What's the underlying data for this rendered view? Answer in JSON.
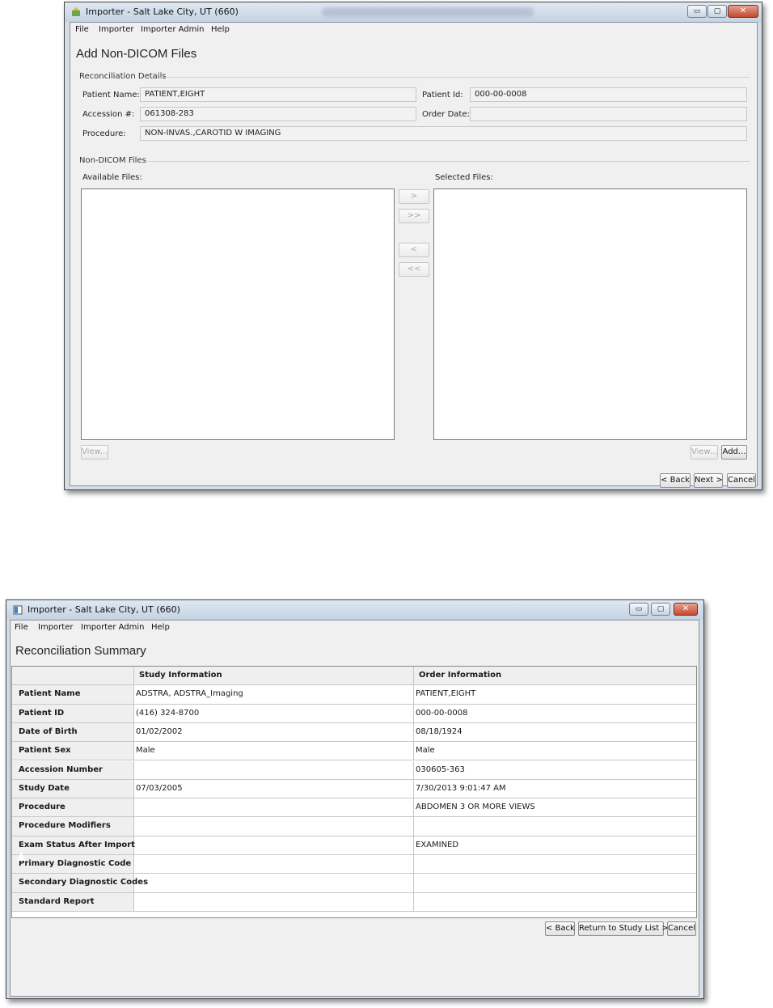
{
  "window1": {
    "title": "Importer - Salt Lake City, UT (660)",
    "menu": [
      "File",
      "Importer",
      "Importer Admin",
      "Help"
    ],
    "heading": "Add Non-DICOM Files",
    "reconciliation": {
      "group_label": "Reconciliation Details",
      "patient_name_label": "Patient Name:",
      "patient_name": "PATIENT,EIGHT",
      "patient_id_label": "Patient Id:",
      "patient_id": "000-00-0008",
      "accession_label": "Accession #:",
      "accession": "061308-283",
      "order_date_label": "Order Date:",
      "order_date": "",
      "procedure_label": "Procedure:",
      "procedure": "NON-INVAS.,CAROTID W IMAGING"
    },
    "files": {
      "group_label": "Non-DICOM Files",
      "available_label": "Available Files:",
      "selected_label": "Selected Files:",
      "move_one": ">",
      "move_all": ">>",
      "remove_one": "<",
      "remove_all": "<<",
      "view_left": "View...",
      "view_right": "View...",
      "add": "Add..."
    },
    "footer": {
      "back": "< Back",
      "next": "Next >",
      "cancel": "Cancel"
    },
    "window_buttons": {
      "minimize": "▭",
      "maximize": "▢",
      "close": "✕"
    }
  },
  "window2": {
    "title": "Importer - Salt Lake City, UT (660)",
    "menu": [
      "File",
      "Importer",
      "Importer Admin",
      "Help"
    ],
    "heading": "Reconciliation Summary",
    "table": {
      "headers": [
        "",
        "Study Information",
        "Order Information"
      ],
      "rows": [
        [
          "Patient Name",
          "ADSTRA, ADSTRA_Imaging",
          "PATIENT,EIGHT"
        ],
        [
          "Patient ID",
          "(416) 324-8700",
          "000-00-0008"
        ],
        [
          "Date of Birth",
          "01/02/2002",
          "08/18/1924"
        ],
        [
          "Patient Sex",
          "Male",
          "Male"
        ],
        [
          "Accession Number",
          "",
          "030605-363"
        ],
        [
          "Study Date",
          "07/03/2005",
          "7/30/2013 9:01:47 AM"
        ],
        [
          "Procedure",
          "",
          "ABDOMEN 3 OR MORE VIEWS"
        ],
        [
          "Procedure Modifiers",
          "",
          ""
        ],
        [
          "Exam Status After Import",
          "",
          "EXAMINED"
        ],
        [
          "Primary Diagnostic Code",
          "",
          ""
        ],
        [
          "Secondary Diagnostic Codes",
          "",
          ""
        ],
        [
          "Standard Report",
          "",
          ""
        ]
      ]
    },
    "footer": {
      "back": "< Back",
      "return": "Return to Study List >",
      "cancel": "Cancel"
    },
    "window_buttons": {
      "minimize": "▭",
      "maximize": "▢",
      "close": "✕"
    }
  }
}
